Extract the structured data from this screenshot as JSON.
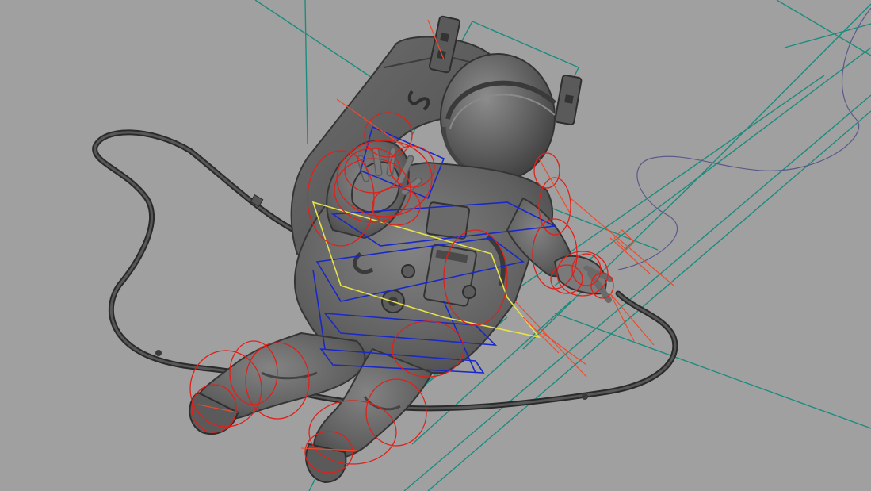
{
  "viewport": {
    "background": "#a0a0a0",
    "model_color": "#6b6b6b",
    "model_shade": "#4e4e4e",
    "model_light": "#8a8a8a",
    "controls": {
      "ik_circle_color": "#e0201a",
      "fk_arrow_color": "#f04a2a",
      "spine_box_color": "#1a28c8",
      "pelvis_box_color": "#e6e14a",
      "camera_line_color": "#1c8c7e",
      "tether_curve_color": "#5a5a8a"
    }
  }
}
